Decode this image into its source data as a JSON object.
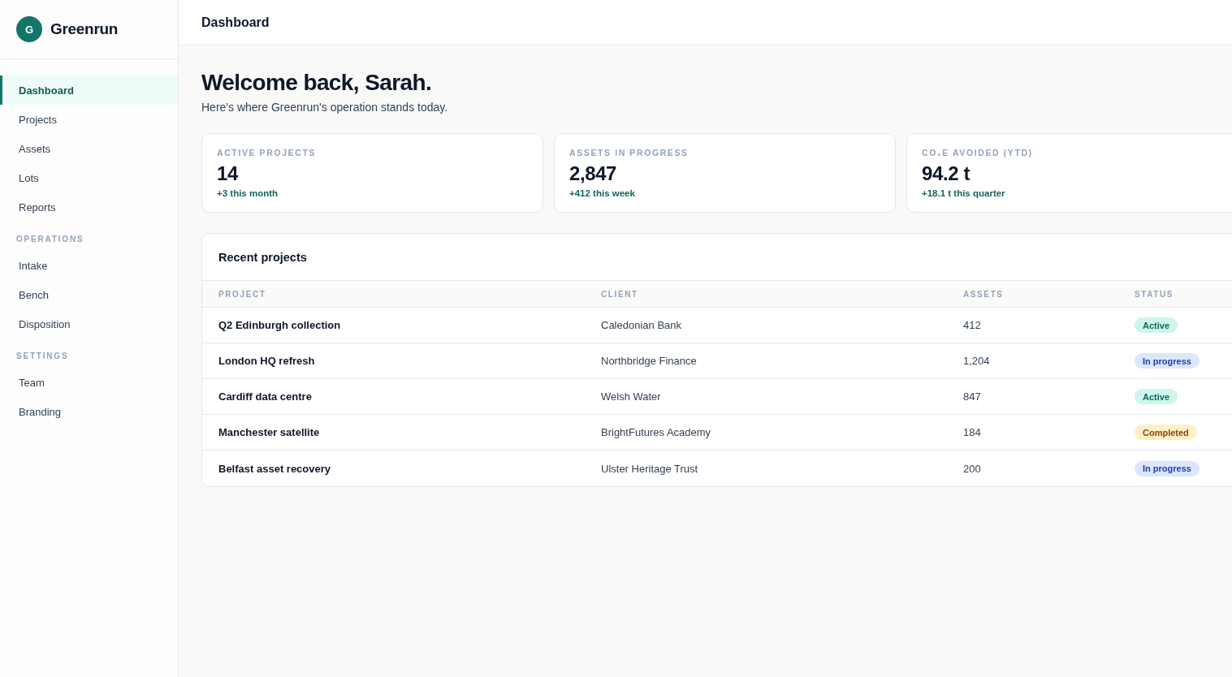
{
  "sidebar": {
    "brand": {
      "initial": "G",
      "name": "Greenrun"
    },
    "sections": [
      {
        "items": [
          {
            "label": "Dashboard",
            "selected": true
          },
          {
            "label": "Projects",
            "selected": false
          },
          {
            "label": "Assets",
            "selected": false
          },
          {
            "label": "Lots",
            "selected": false
          },
          {
            "label": "Reports",
            "selected": false
          }
        ]
      },
      {
        "title": "OPERATIONS",
        "items": [
          {
            "label": "Intake",
            "selected": false
          },
          {
            "label": "Bench",
            "selected": false
          },
          {
            "label": "Disposition",
            "selected": false
          }
        ]
      },
      {
        "title": "SETTINGS",
        "items": [
          {
            "label": "Team",
            "selected": false
          },
          {
            "label": "Branding",
            "selected": false
          }
        ]
      }
    ]
  },
  "header": {
    "title": "Dashboard"
  },
  "welcome": {
    "heading": "Welcome back, Sarah.",
    "subtitle": "Here's where Greenrun's operation stands today."
  },
  "stats": [
    {
      "label": "ACTIVE PROJECTS",
      "value": "14",
      "delta": "+3 this month"
    },
    {
      "label": "ASSETS IN PROGRESS",
      "value": "2,847",
      "delta": "+412 this week"
    },
    {
      "label": "CO₂E AVOIDED (YTD)",
      "value": "94.2 t",
      "delta": "+18.1 t this quarter"
    }
  ],
  "table": {
    "title": "Recent projects",
    "columns": [
      "PROJECT",
      "CLIENT",
      "ASSETS",
      "STATUS"
    ],
    "rows": [
      {
        "project": "Q2 Edinburgh collection",
        "client": "Caledonian Bank",
        "assets": "412",
        "status": {
          "label": "Active",
          "kind": "active"
        }
      },
      {
        "project": "London HQ refresh",
        "client": "Northbridge Finance",
        "assets": "1,204",
        "status": {
          "label": "In progress",
          "kind": "progress"
        }
      },
      {
        "project": "Cardiff data centre",
        "client": "Welsh Water",
        "assets": "847",
        "status": {
          "label": "Active",
          "kind": "active"
        }
      },
      {
        "project": "Manchester satellite",
        "client": "BrightFutures Academy",
        "assets": "184",
        "status": {
          "label": "Completed",
          "kind": "completed"
        }
      },
      {
        "project": "Belfast asset recovery",
        "client": "Ulster Heritage Trust",
        "assets": "200",
        "status": {
          "label": "In progress",
          "kind": "progress"
        }
      }
    ]
  }
}
